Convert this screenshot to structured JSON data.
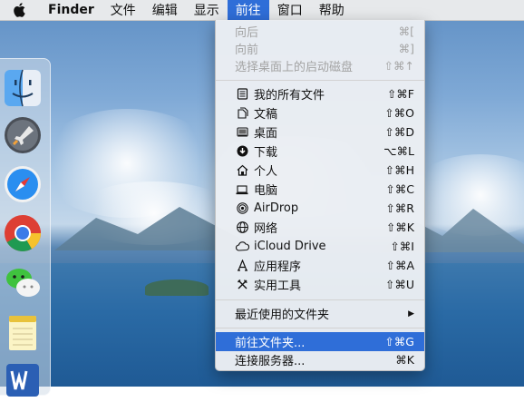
{
  "menubar": {
    "app": "Finder",
    "items": [
      "文件",
      "编辑",
      "显示",
      "前往",
      "窗口",
      "帮助"
    ],
    "active_index": 3
  },
  "menu": {
    "history": [
      {
        "label": "向后",
        "shortcut": "⌘[",
        "disabled": true
      },
      {
        "label": "向前",
        "shortcut": "⌘]",
        "disabled": true
      },
      {
        "label": "选择桌面上的启动磁盘",
        "shortcut": "⇧⌘↑",
        "disabled": true
      }
    ],
    "places": [
      {
        "label": "我的所有文件",
        "shortcut": "⇧⌘F",
        "icon": "all-files-icon"
      },
      {
        "label": "文稿",
        "shortcut": "⇧⌘O",
        "icon": "documents-icon"
      },
      {
        "label": "桌面",
        "shortcut": "⇧⌘D",
        "icon": "desktop-icon"
      },
      {
        "label": "下载",
        "shortcut": "⌥⌘L",
        "icon": "downloads-icon"
      },
      {
        "label": "个人",
        "shortcut": "⇧⌘H",
        "icon": "home-icon"
      },
      {
        "label": "电脑",
        "shortcut": "⇧⌘C",
        "icon": "computer-icon"
      },
      {
        "label": "AirDrop",
        "shortcut": "⇧⌘R",
        "icon": "airdrop-icon"
      },
      {
        "label": "网络",
        "shortcut": "⇧⌘K",
        "icon": "network-icon"
      },
      {
        "label": "iCloud Drive",
        "shortcut": "⇧⌘I",
        "icon": "icloud-icon"
      },
      {
        "label": "应用程序",
        "shortcut": "⇧⌘A",
        "icon": "applications-icon"
      },
      {
        "label": "实用工具",
        "shortcut": "⇧⌘U",
        "icon": "utilities-icon"
      }
    ],
    "recent": {
      "label": "最近使用的文件夹",
      "shortcut": "▶"
    },
    "goto_folder": {
      "label": "前往文件夹...",
      "shortcut": "⇧⌘G",
      "highlighted": true
    },
    "connect": {
      "label": "连接服务器...",
      "shortcut": "⌘K"
    }
  },
  "dock": {
    "icons": [
      "finder-icon",
      "launchpad-icon",
      "safari-icon",
      "chrome-icon",
      "wechat-icon",
      "notes-icon",
      "word-icon"
    ]
  },
  "colors": {
    "highlight": "#2f6ed8",
    "menu_bg": "#ebeef3"
  }
}
